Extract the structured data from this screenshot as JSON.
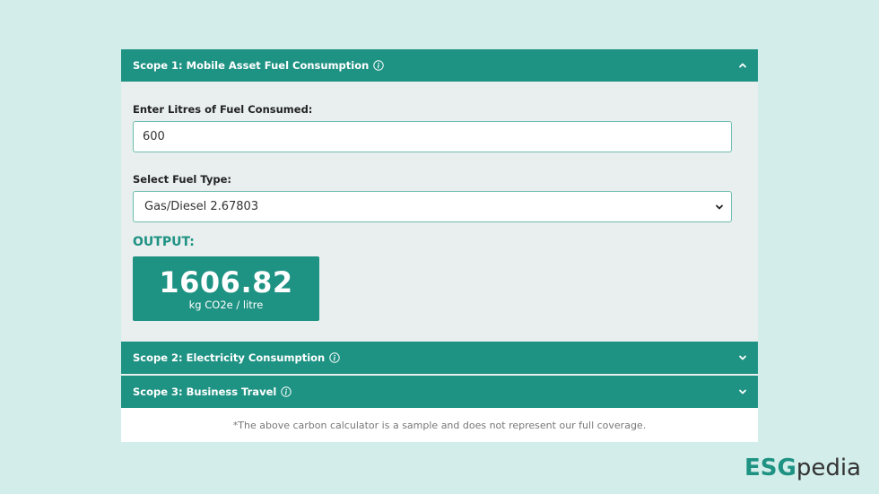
{
  "scopes": [
    {
      "title": "Scope 1: Mobile Asset Fuel Consumption",
      "expanded": true,
      "litres_label": "Enter Litres of Fuel Consumed:",
      "litres_value": "600",
      "fuel_label": "Select Fuel Type:",
      "fuel_value": "Gas/Diesel 2.67803",
      "output_label": "OUTPUT:",
      "output_value": "1606.82",
      "output_unit": "kg CO2e / litre"
    },
    {
      "title": "Scope 2: Electricity Consumption",
      "expanded": false
    },
    {
      "title": "Scope 3: Business Travel",
      "expanded": false
    }
  ],
  "footnote": "*The above carbon calculator is a sample and does not represent our full coverage.",
  "brand": {
    "part1": "ESG",
    "part2": "pedia"
  },
  "icons": {
    "info": "info-icon",
    "expanded": "chevron-up-icon",
    "collapsed": "chevron-down-icon",
    "select": "chevron-down-icon"
  },
  "colors": {
    "background": "#d3eeea",
    "accent": "#1e9283",
    "panel": "#e8efee",
    "input_border": "#6dbcaf"
  }
}
